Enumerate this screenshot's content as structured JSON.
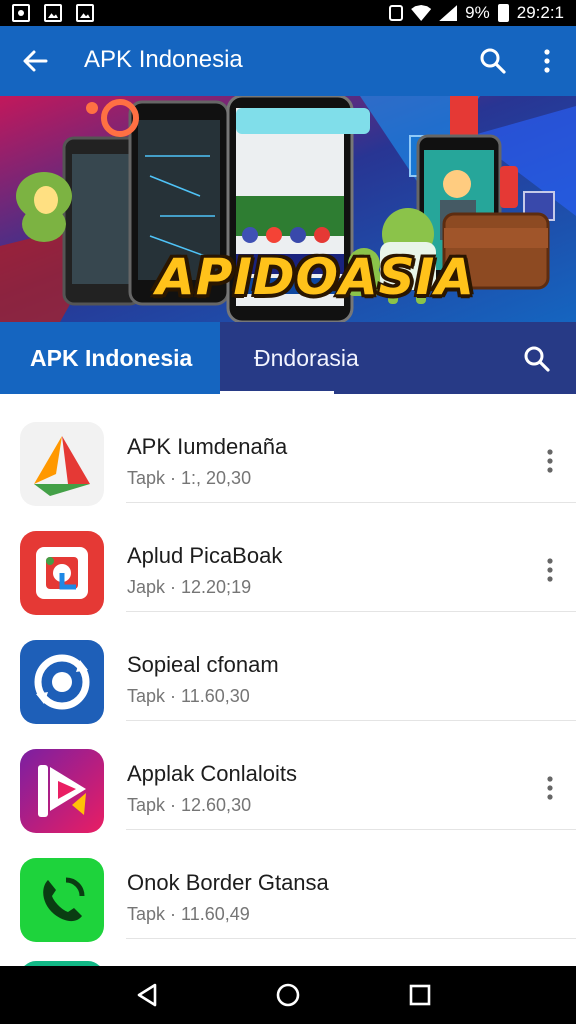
{
  "status_bar": {
    "battery": "9%",
    "time": "29:2:1"
  },
  "app_bar": {
    "title": "APK Indonesia",
    "back_icon": "arrow-left-icon",
    "search_icon": "search-icon",
    "more_icon": "more-vertical-icon",
    "color": "#1565c0"
  },
  "banner": {
    "title": "APIDOASIA"
  },
  "tabs": [
    {
      "label": "APK Indonesia",
      "selected": false
    },
    {
      "label": "Đndorasia",
      "selected": true
    }
  ],
  "tab_bar_color": "#273a86",
  "apps": [
    {
      "name": "APK Iumdenaña",
      "sub": "Tapk · 1:, 20,30",
      "has_menu": true,
      "icon": "triangle-logo-icon"
    },
    {
      "name": "Aplud PicaBoak",
      "sub": "Japk · 12.20;19",
      "has_menu": true,
      "icon": "red-frame-logo-icon"
    },
    {
      "name": "Sopieal cfonam",
      "sub": "Tapk · 11.60,30",
      "has_menu": false,
      "icon": "circular-arrows-icon"
    },
    {
      "name": "Applak Conlaloits",
      "sub": "Tapk · 12.60,30",
      "has_menu": true,
      "icon": "play-logo-icon"
    },
    {
      "name": "Onok Border Gtansa",
      "sub": "Tapk · 11.60,49",
      "has_menu": false,
      "icon": "phone-logo-icon"
    }
  ],
  "nav_bar": {
    "back": "nav-back-icon",
    "home": "nav-home-icon",
    "recents": "nav-recents-icon"
  }
}
